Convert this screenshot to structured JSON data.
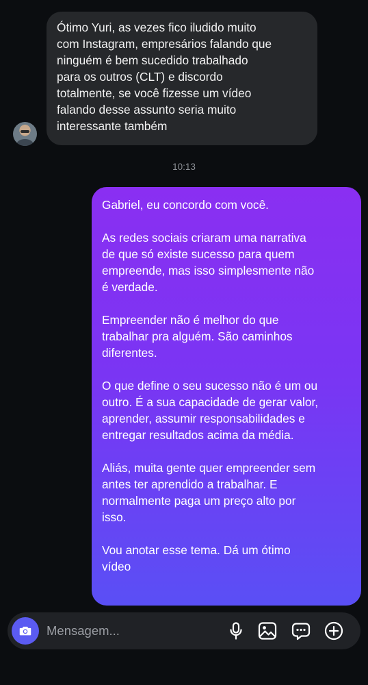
{
  "incoming": {
    "lines": [
      "Ótimo Yuri, as vezes fico iludido muito",
      "com Instagram, empresários falando que",
      "ninguém é bem sucedido trabalhado",
      "para os outros (CLT) e discordo",
      "totalmente, se você fizesse um vídeo",
      "falando desse assunto seria muito",
      "interessante também"
    ]
  },
  "timestamp": "10:13",
  "outgoing": {
    "paragraphs": [
      [
        "Gabriel, eu concordo com você."
      ],
      [
        "As redes sociais criaram uma narrativa",
        "de que só existe sucesso para quem",
        "empreende, mas isso simplesmente não",
        "é verdade."
      ],
      [
        "Empreender não é melhor do que",
        "trabalhar pra alguém. São caminhos",
        "diferentes."
      ],
      [
        "O que define o seu sucesso não é um ou",
        "outro. É a sua capacidade de gerar valor,",
        "aprender, assumir responsabilidades e",
        "entregar resultados acima da média."
      ],
      [
        "Aliás, muita gente quer empreender sem",
        "antes ter aprendido a trabalhar. E",
        "normalmente paga um preço alto por",
        "isso."
      ],
      [
        "Vou anotar esse tema. Dá um ótimo",
        "vídeo"
      ]
    ]
  },
  "composer": {
    "placeholder": "Mensagem...",
    "icons": [
      "camera-icon",
      "microphone-icon",
      "image-icon",
      "sticker-chat-icon",
      "plus-circle-icon"
    ]
  },
  "colors": {
    "background": "#0b0d10",
    "incoming_bubble": "#26282b",
    "outgoing_gradient_top": "#8a2ff2",
    "outgoing_gradient_bottom": "#5a4ff5",
    "camera_button": "#5b5bf2"
  }
}
